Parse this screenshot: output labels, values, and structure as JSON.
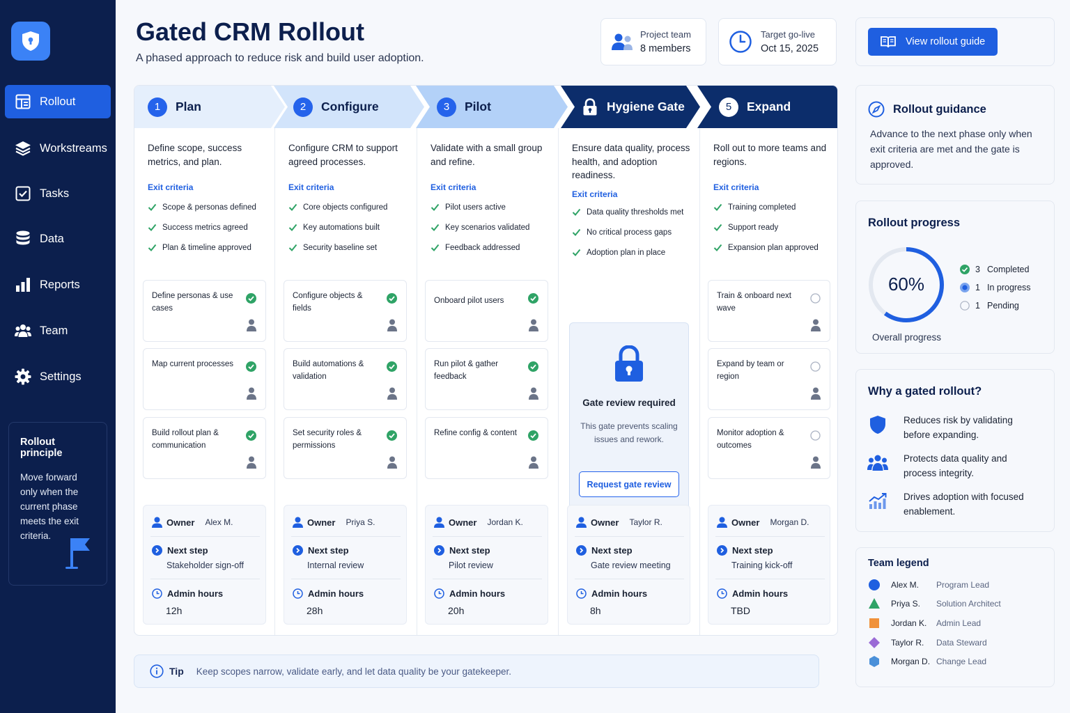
{
  "sidebar": {
    "logo": "shield-icon",
    "items": [
      {
        "label": "Rollout",
        "icon": "layout-icon",
        "active": true
      },
      {
        "label": "Workstreams",
        "icon": "layers-icon"
      },
      {
        "label": "Tasks",
        "icon": "checkbox-icon"
      },
      {
        "label": "Data",
        "icon": "database-icon"
      },
      {
        "label": "Reports",
        "icon": "bar-chart-icon"
      },
      {
        "label": "Team",
        "icon": "team-icon"
      },
      {
        "label": "Settings",
        "icon": "gear-icon"
      }
    ],
    "principle": {
      "title": "Rollout principle",
      "text": "Move forward only when the current phase meets the exit criteria."
    }
  },
  "header": {
    "title": "Gated CRM Rollout",
    "subtitle": "A phased approach to reduce risk and build user adoption.",
    "team": {
      "label": "Project team",
      "value": "8 members"
    },
    "golive": {
      "label": "Target go-live",
      "value": "Oct 15, 2025"
    },
    "guide_button": "View rollout guide"
  },
  "phases": [
    {
      "num": "1",
      "name": "Plan",
      "desc": "Define scope, success metrics, and plan.",
      "exit_title": "Exit criteria",
      "criteria": [
        "Scope & personas defined",
        "Success metrics agreed",
        "Plan & timeline approved"
      ],
      "tasks": [
        {
          "label": "Define personas & use cases",
          "status": "done"
        },
        {
          "label": "Map current processes",
          "status": "done"
        },
        {
          "label": "Build rollout plan & communication",
          "status": "done"
        }
      ],
      "owner_label": "Owner",
      "owner": "Alex M.",
      "next_label": "Next step",
      "next": "Stakeholder sign-off",
      "hours_label": "Admin hours",
      "hours": "12h"
    },
    {
      "num": "2",
      "name": "Configure",
      "desc": "Configure CRM to support agreed processes.",
      "exit_title": "Exit criteria",
      "criteria": [
        "Core objects configured",
        "Key automations built",
        "Security baseline set"
      ],
      "tasks": [
        {
          "label": "Configure objects & fields",
          "status": "done"
        },
        {
          "label": "Build automations & validation",
          "status": "done"
        },
        {
          "label": "Set security roles & permissions",
          "status": "done"
        }
      ],
      "owner_label": "Owner",
      "owner": "Priya S.",
      "next_label": "Next step",
      "next": "Internal review",
      "hours_label": "Admin hours",
      "hours": "28h"
    },
    {
      "num": "3",
      "name": "Pilot",
      "desc": "Validate with a small group and refine.",
      "exit_title": "Exit criteria",
      "criteria": [
        "Pilot users active",
        "Key scenarios validated",
        "Feedback addressed"
      ],
      "tasks": [
        {
          "label": "Onboard pilot users",
          "status": "done"
        },
        {
          "label": "Run pilot & gather feedback",
          "status": "done"
        },
        {
          "label": "Refine config & content",
          "status": "done"
        }
      ],
      "owner_label": "Owner",
      "owner": "Jordan K.",
      "next_label": "Next step",
      "next": "Pilot review",
      "hours_label": "Admin hours",
      "hours": "20h"
    },
    {
      "num": "",
      "name": "Hygiene Gate",
      "desc": "Ensure data quality, process health, and adoption readiness.",
      "exit_title": "Exit criteria",
      "criteria": [
        "Data quality thresholds met",
        "No critical process gaps",
        "Adoption plan in place"
      ],
      "gate": {
        "title": "Gate review required",
        "text": "This gate prevents scaling issues and rework.",
        "button": "Request gate review"
      },
      "owner_label": "Owner",
      "owner": "Taylor R.",
      "next_label": "Next step",
      "next": "Gate review meeting",
      "hours_label": "Admin hours",
      "hours": "8h"
    },
    {
      "num": "5",
      "name": "Expand",
      "desc": "Roll out to more teams and regions.",
      "exit_title": "Exit criteria",
      "criteria": [
        "Training completed",
        "Support ready",
        "Expansion plan approved"
      ],
      "tasks": [
        {
          "label": "Train & onboard next wave",
          "status": "pending"
        },
        {
          "label": "Expand by team or region",
          "status": "pending"
        },
        {
          "label": "Monitor adoption & outcomes",
          "status": "pending"
        }
      ],
      "owner_label": "Owner",
      "owner": "Morgan D.",
      "next_label": "Next step",
      "next": "Training kick-off",
      "hours_label": "Admin hours",
      "hours": "TBD"
    }
  ],
  "tip": {
    "label": "Tip",
    "text": "Keep scopes narrow, validate early, and let data quality be your gatekeeper."
  },
  "guidance": {
    "title": "Rollout guidance",
    "text": "Advance to the next phase only when exit criteria are met and the gate is approved."
  },
  "progress": {
    "title": "Rollout progress",
    "percent_label": "60%",
    "percent": 60,
    "caption": "Overall progress",
    "legend": [
      {
        "count": "3",
        "label": "Completed"
      },
      {
        "count": "1",
        "label": "In progress"
      },
      {
        "count": "1",
        "label": "Pending"
      }
    ]
  },
  "why": {
    "title": "Why a gated rollout?",
    "items": [
      {
        "icon": "shield-icon",
        "text": "Reduces risk by validating before expanding."
      },
      {
        "icon": "people-icon",
        "text": "Protects data quality and process integrity."
      },
      {
        "icon": "growth-chart-icon",
        "text": "Drives adoption with focused enablement."
      }
    ]
  },
  "team_legend": {
    "title": "Team legend",
    "members": [
      {
        "name": "Alex M.",
        "role": "Program Lead",
        "shape": "circle",
        "color": "#1f5fe0"
      },
      {
        "name": "Priya S.",
        "role": "Solution Architect",
        "shape": "triangle",
        "color": "#2fa366"
      },
      {
        "name": "Jordan K.",
        "role": "Admin Lead",
        "shape": "square",
        "color": "#f0913a"
      },
      {
        "name": "Taylor R.",
        "role": "Data Steward",
        "shape": "diamond",
        "color": "#9a6bd6"
      },
      {
        "name": "Morgan D.",
        "role": "Change Lead",
        "shape": "hexagon",
        "color": "#4a90d9"
      }
    ]
  },
  "colors": {
    "sidebar": "#0c1f4d",
    "accent": "#1f5fe0",
    "success": "#2fa366",
    "gate": "#0c2d6b"
  }
}
